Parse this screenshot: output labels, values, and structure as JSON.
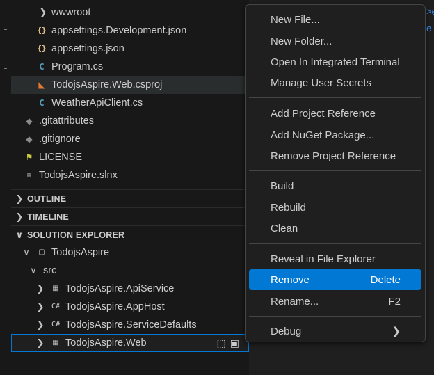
{
  "explorer": {
    "files": [
      {
        "label": "wwwroot",
        "icon": "chevron-right-icon"
      },
      {
        "label": "appsettings.Development.json",
        "icon": "json-braces-icon"
      },
      {
        "label": "appsettings.json",
        "icon": "json-braces-icon"
      },
      {
        "label": "Program.cs",
        "icon": "csharp-file-icon"
      },
      {
        "label": "TodojsAspire.Web.csproj",
        "icon": "rss-icon"
      },
      {
        "label": "WeatherApiClient.cs",
        "icon": "csharp-file-icon"
      },
      {
        "label": ".gitattributes",
        "icon": "git-icon"
      },
      {
        "label": ".gitignore",
        "icon": "git-icon"
      },
      {
        "label": "LICENSE",
        "icon": "license-icon"
      },
      {
        "label": "TodojsAspire.slnx",
        "icon": "solution-file-icon"
      }
    ],
    "sections": {
      "outline": "OUTLINE",
      "timeline": "TIMELINE",
      "solution_explorer": "SOLUTION EXPLORER"
    },
    "solution": {
      "name": "TodojsAspire",
      "folder": "src",
      "projects": [
        "TodojsAspire.ApiService",
        "TodojsAspire.AppHost",
        "TodojsAspire.ServiceDefaults",
        "TodojsAspire.Web"
      ]
    }
  },
  "editor": {
    "snippets": [
      ">e",
      "e"
    ]
  },
  "context_menu": {
    "groups": [
      [
        {
          "label": "New File...",
          "shortcut": ""
        },
        {
          "label": "New Folder...",
          "shortcut": ""
        },
        {
          "label": "Open In Integrated Terminal",
          "shortcut": ""
        },
        {
          "label": "Manage User Secrets",
          "shortcut": ""
        }
      ],
      [
        {
          "label": "Add Project Reference",
          "shortcut": ""
        },
        {
          "label": "Add NuGet Package...",
          "shortcut": ""
        },
        {
          "label": "Remove Project Reference",
          "shortcut": ""
        }
      ],
      [
        {
          "label": "Build",
          "shortcut": ""
        },
        {
          "label": "Rebuild",
          "shortcut": ""
        },
        {
          "label": "Clean",
          "shortcut": ""
        }
      ],
      [
        {
          "label": "Reveal in File Explorer",
          "shortcut": ""
        },
        {
          "label": "Remove",
          "shortcut": "Delete"
        },
        {
          "label": "Rename...",
          "shortcut": "F2"
        }
      ],
      [
        {
          "label": "Debug",
          "shortcut": ""
        }
      ]
    ],
    "highlighted": "Remove"
  },
  "colors": {
    "accent": "#0078d4",
    "background": "#181818",
    "menu_background": "#1f1f1f"
  }
}
